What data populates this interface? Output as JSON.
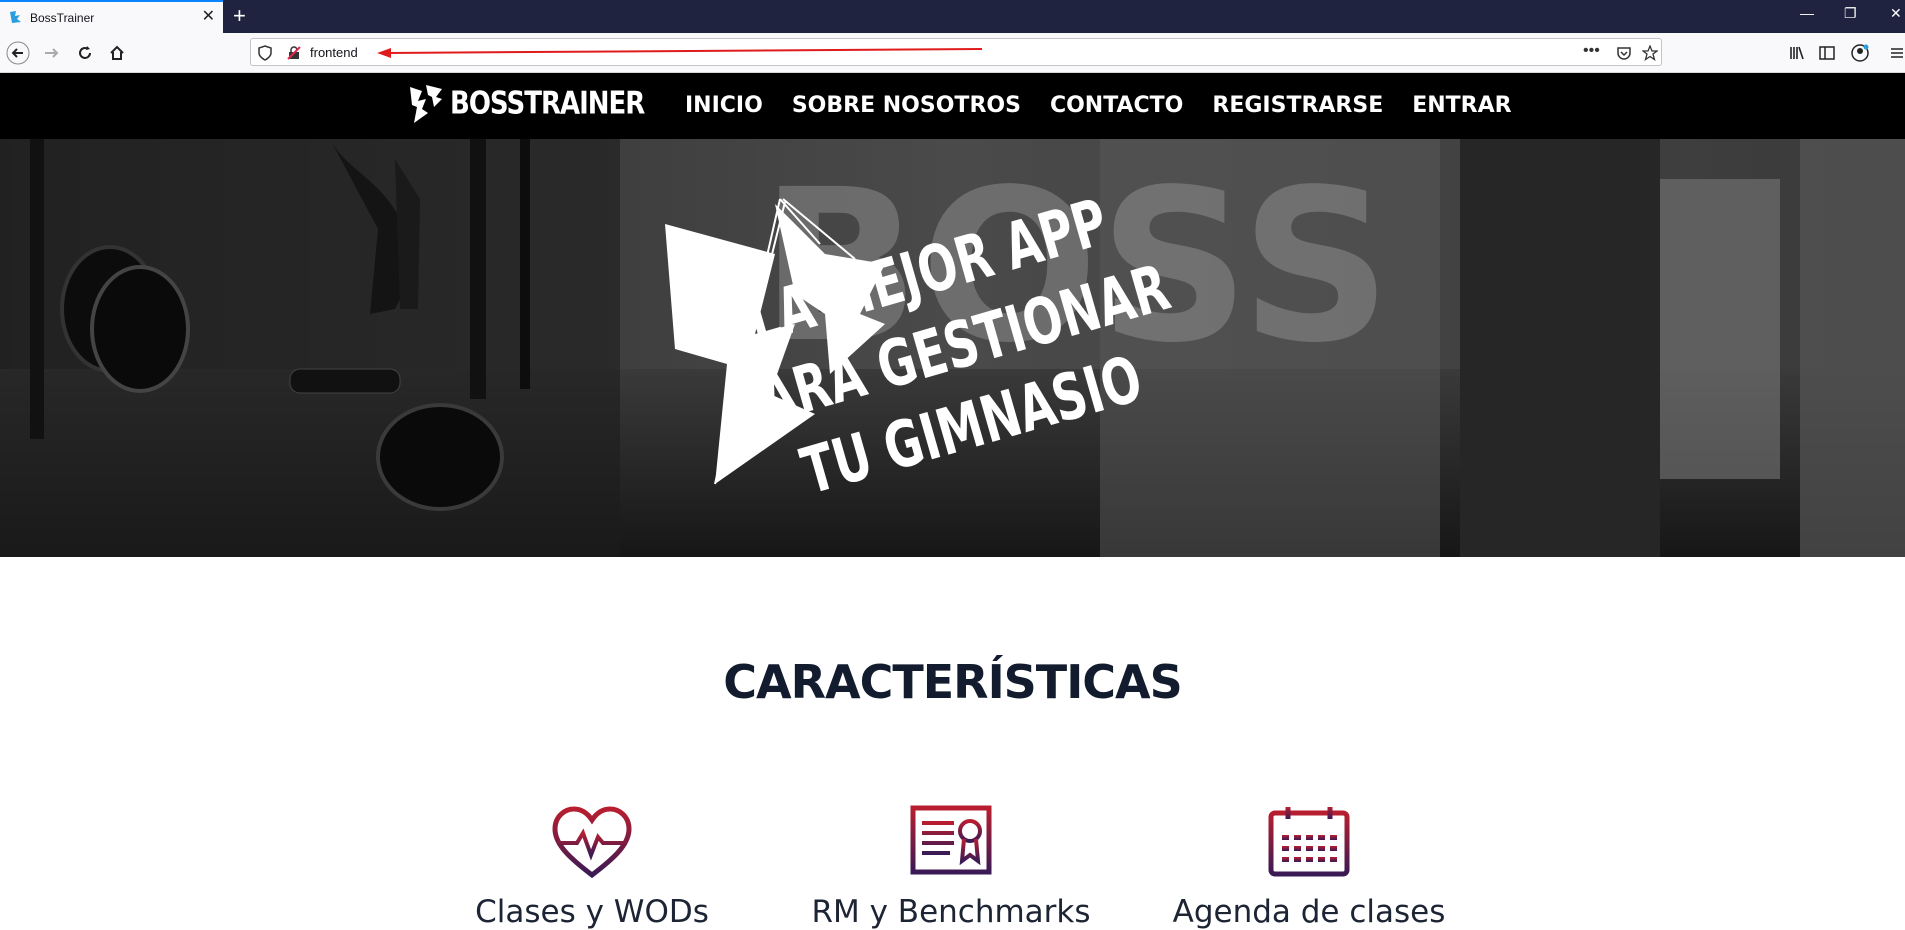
{
  "browser": {
    "tab_title": "BossTrainer",
    "url": "frontend"
  },
  "site": {
    "logo_text": "BOSSTRAINER",
    "nav": [
      "INICIO",
      "SOBRE NOSOTROS",
      "CONTACTO",
      "REGISTRARSE",
      "ENTRAR"
    ],
    "hero_lines": [
      "LA MEJOR APP",
      "PARA GESTIONAR",
      "TU GIMNASIO"
    ],
    "section_title": "CARACTERÍSTICAS",
    "features": [
      {
        "label": "Clases y WODs",
        "icon": "heart-pulse-icon"
      },
      {
        "label": "RM y Benchmarks",
        "icon": "certificate-icon"
      },
      {
        "label": "Agenda de clases",
        "icon": "calendar-icon"
      }
    ],
    "accent_gradient": [
      "#b81e2f",
      "#3a1a55"
    ]
  }
}
